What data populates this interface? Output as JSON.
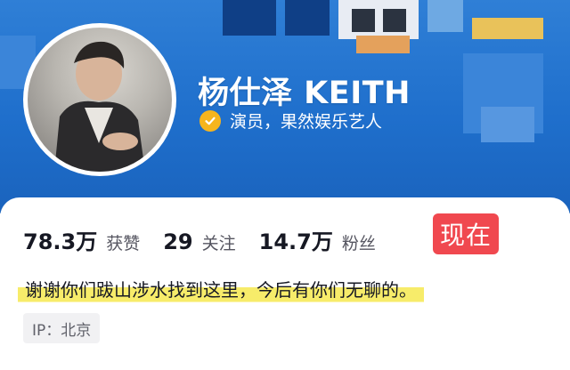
{
  "profile": {
    "name": "杨仕泽 KEITH",
    "verification": "演员，果然娱乐艺人",
    "verify_icon": "verified-check-icon",
    "bio": "谢谢你们跋山涉水找到这里，今后有你们无聊的。",
    "ip_location": "IP：北京"
  },
  "stats": {
    "likes_value": "78.3万",
    "likes_label": "获赞",
    "following_value": "29",
    "following_label": "关注",
    "followers_value": "14.7万",
    "followers_label": "粉丝"
  },
  "badge": {
    "label": "现在"
  },
  "colors": {
    "banner": "#1f6fcc",
    "badge": "#f0484f",
    "verify": "#f6b51e",
    "highlight": "#f7ec6a"
  }
}
